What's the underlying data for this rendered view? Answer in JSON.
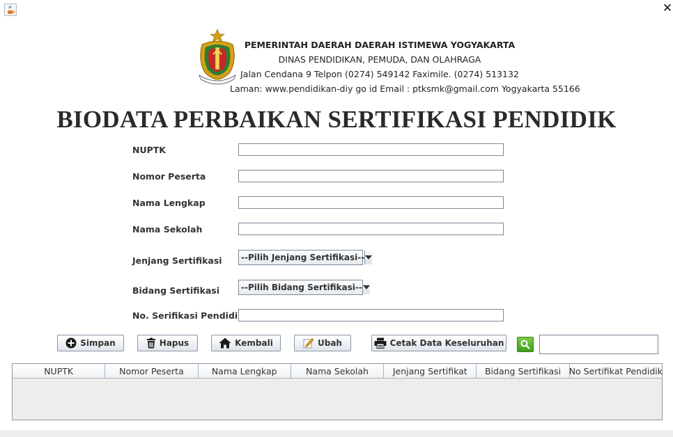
{
  "header": {
    "line1": "PEMERINTAH DAERAH DAERAH ISTIMEWA YOGYAKARTA",
    "line2": "DINAS PENDIDIKAN, PEMUDA, DAN OLAHRAGA",
    "line3": "Jalan Cendana 9 Telpon (0274) 549142 Faximile. (0274) 513132",
    "line4": "Laman: www.pendidikan-diy go id Email : ptksmk@gmail.com Yogyakarta 55166"
  },
  "title": "BIODATA PERBAIKAN SERTIFIKASI PENDIDIK",
  "form": {
    "nuptk_label": "NUPTK",
    "nuptk_value": "",
    "nomor_peserta_label": "Nomor Peserta",
    "nomor_peserta_value": "",
    "nama_lengkap_label": "Nama Lengkap",
    "nama_lengkap_value": "",
    "nama_sekolah_label": "Nama Sekolah",
    "nama_sekolah_value": "",
    "jenjang_label": "Jenjang Sertifikasi",
    "jenjang_selected": "--Pilih Jenjang Sertifikasi--",
    "bidang_label": "Bidang Sertifikasi",
    "bidang_selected": "--Pilih Bidang Sertifikasi--",
    "no_sertifikasi_label": "No. Serifikasi Pendidik",
    "no_sertifikasi_value": ""
  },
  "buttons": {
    "simpan": "Simpan",
    "hapus": "Hapus",
    "kembali": "Kembali",
    "ubah": "Ubah",
    "cetak": "Cetak Data Keseluruhan"
  },
  "search": {
    "value": ""
  },
  "table": {
    "columns": [
      "NUPTK",
      "Nomor Peserta",
      "Nama Lengkap",
      "Nama Sekolah",
      "Jenjang Sertifikat",
      "Bidang Sertifikasi",
      "No Sertifikat Pendidik"
    ],
    "rows": []
  },
  "colors": {
    "search_green": "#4caf2a",
    "logo_gold": "#d4a017",
    "logo_red": "#c62828",
    "logo_green": "#2e7d32"
  },
  "icons": {
    "window": "java-cup-icon",
    "close": "close-icon",
    "simpan": "plus-circle-icon",
    "hapus": "trash-icon",
    "kembali": "home-icon",
    "ubah": "edit-icon",
    "cetak": "printer-icon",
    "search": "search-icon"
  }
}
